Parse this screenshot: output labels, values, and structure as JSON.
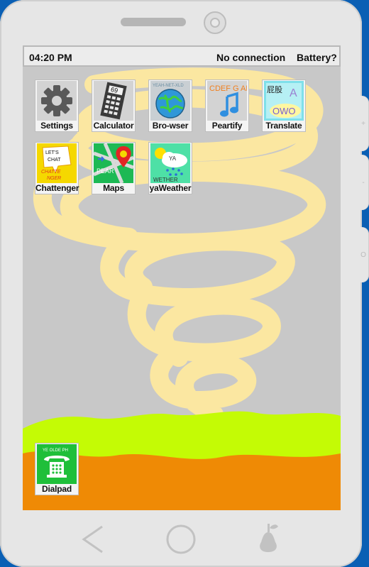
{
  "status_bar": {
    "time": "04:20 PM",
    "connection": "No connection",
    "battery": "Battery?"
  },
  "apps": [
    {
      "label": "Settings",
      "icon": "gear-icon"
    },
    {
      "label": "Calculator",
      "icon": "calculator-icon"
    },
    {
      "label": "Bro-wser",
      "icon": "globe-icon"
    },
    {
      "label": "Peartify",
      "icon": "music-note-icon"
    },
    {
      "label": "Translate",
      "icon": "translate-icon"
    },
    {
      "label": "Chattenger",
      "icon": "chat-icon"
    },
    {
      "label": "Maps",
      "icon": "map-pin-icon"
    },
    {
      "label": "yaWeather",
      "icon": "weather-cloud-icon"
    }
  ],
  "dock": {
    "dialpad": {
      "label": "Dialpad",
      "icon": "phone-icon",
      "icon_text": "YE OLDE PH"
    }
  },
  "icon_text": {
    "calculator_display": "69",
    "browser_banner": "YEAH-NET-XLD",
    "peartify_letters": "CDEF G AB C",
    "translate_top": "屁股",
    "translate_letter": "A",
    "translate_bottom": "OWO",
    "chat_line1": "LET'S",
    "chat_line2": "CHAT",
    "chat_line3": "CHATTE",
    "chat_line4": "NGER",
    "maps_text": "PEAR",
    "weather_top": "YA",
    "weather_bottom": "WETHER"
  },
  "navigation": {
    "back": "back-icon",
    "home": "home-icon",
    "recents": "pear-logo-icon"
  },
  "side_buttons": {
    "volume_up": "+",
    "volume_down": "-",
    "power": "O"
  },
  "colors": {
    "phone_body": "#e6e6e6",
    "desktop_bg": "#0a5fb4",
    "screen_bg": "#c8c8c8",
    "tornado": "#fbe7a1",
    "grass": "#c4fb05",
    "ground": "#ef8a05"
  }
}
